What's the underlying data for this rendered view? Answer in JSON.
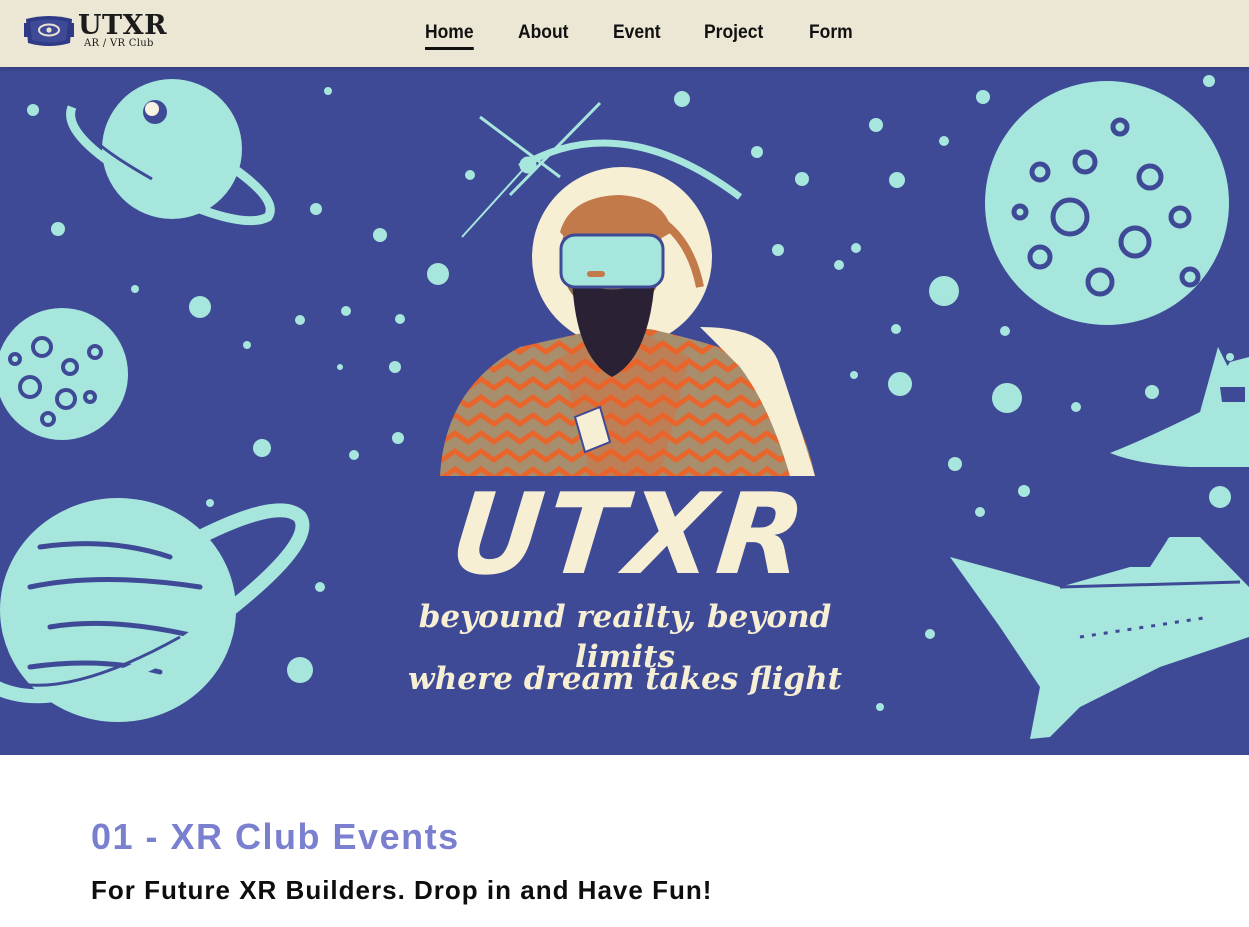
{
  "brand": {
    "name": "UTXR",
    "subtitle": "AR / VR Club",
    "logo_icon": "vr-headset-icon"
  },
  "nav": {
    "items": [
      {
        "label": "Home",
        "active": true
      },
      {
        "label": "About",
        "active": false
      },
      {
        "label": "Event",
        "active": false
      },
      {
        "label": "Project",
        "active": false
      },
      {
        "label": "Form",
        "active": false
      }
    ]
  },
  "hero": {
    "title": "UTXR",
    "tagline_1": "beyound reailty, beyond limits",
    "tagline_2": "where dream takes flight",
    "colors": {
      "background": "#3f4a97",
      "illustration": "#a6e6dc",
      "cream": "#f6efd4",
      "accent_orange": "#e8652c"
    }
  },
  "section": {
    "heading": "01 - XR Club Events",
    "subheading": "For Future XR Builders. Drop in and Have Fun!",
    "heading_color": "#7b7fcf"
  }
}
